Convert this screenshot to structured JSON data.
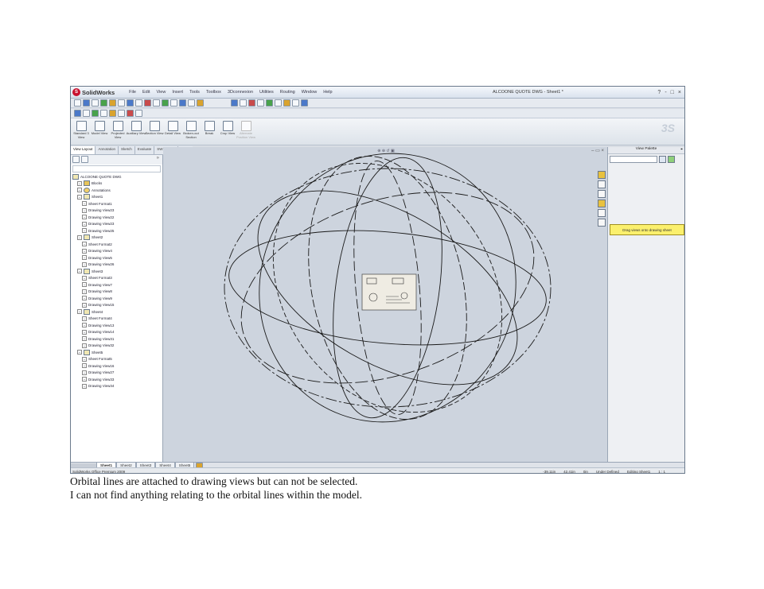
{
  "app": {
    "name": "SolidWorks",
    "menus": [
      "File",
      "Edit",
      "View",
      "Insert",
      "Tools",
      "Toolbox",
      "3Dconnexion",
      "Utilities",
      "Routing",
      "Window",
      "Help"
    ],
    "document_title": "ALCOONE QUOTE DWG - Sheet1 *",
    "window_controls": [
      "?",
      "-",
      "□",
      "×"
    ]
  },
  "command_manager": {
    "buttons": [
      {
        "label": "Standard 3 View",
        "disabled": false
      },
      {
        "label": "Model View",
        "disabled": false
      },
      {
        "label": "Projected View",
        "disabled": false
      },
      {
        "label": "Auxiliary View",
        "disabled": false
      },
      {
        "label": "Section View",
        "disabled": false
      },
      {
        "label": "Detail View",
        "disabled": false
      },
      {
        "label": "Broken-out Section",
        "disabled": false
      },
      {
        "label": "Break",
        "disabled": false
      },
      {
        "label": "Crop View",
        "disabled": false
      },
      {
        "label": "Alternate Position View",
        "disabled": true
      }
    ]
  },
  "tabs": [
    "View Layout",
    "Annotation",
    "Sketch",
    "Evaluate",
    "SWSimport"
  ],
  "tree": {
    "nodes": [
      {
        "label": "ALCOONE QUOTE DWG",
        "level": 0,
        "icon": "sheet"
      },
      {
        "label": "Blocks",
        "level": 1,
        "icon": "folder"
      },
      {
        "label": "Annotations",
        "level": 1,
        "icon": "anno"
      },
      {
        "label": "Sheet1",
        "level": 1,
        "icon": "sheet"
      },
      {
        "label": "Sheet Format1",
        "level": 2,
        "icon": "view"
      },
      {
        "label": "Drawing View23",
        "level": 2,
        "icon": "view"
      },
      {
        "label": "Drawing View22",
        "level": 2,
        "icon": "view"
      },
      {
        "label": "Drawing View23",
        "level": 2,
        "icon": "view"
      },
      {
        "label": "Drawing View25",
        "level": 2,
        "icon": "view"
      },
      {
        "label": "Sheet2",
        "level": 1,
        "icon": "sheet"
      },
      {
        "label": "Sheet Format2",
        "level": 2,
        "icon": "view"
      },
      {
        "label": "Drawing View4",
        "level": 2,
        "icon": "view"
      },
      {
        "label": "Drawing View5",
        "level": 2,
        "icon": "view"
      },
      {
        "label": "Drawing View26",
        "level": 2,
        "icon": "view"
      },
      {
        "label": "Sheet3",
        "level": 1,
        "icon": "sheet"
      },
      {
        "label": "Sheet Format3",
        "level": 2,
        "icon": "view"
      },
      {
        "label": "Drawing View7",
        "level": 2,
        "icon": "view"
      },
      {
        "label": "Drawing View8",
        "level": 2,
        "icon": "view"
      },
      {
        "label": "Drawing View9",
        "level": 2,
        "icon": "view"
      },
      {
        "label": "Drawing View15",
        "level": 2,
        "icon": "view"
      },
      {
        "label": "Sheet4",
        "level": 1,
        "icon": "sheet"
      },
      {
        "label": "Sheet Format4",
        "level": 2,
        "icon": "view"
      },
      {
        "label": "Drawing View13",
        "level": 2,
        "icon": "view"
      },
      {
        "label": "Drawing View14",
        "level": 2,
        "icon": "view"
      },
      {
        "label": "Drawing View31",
        "level": 2,
        "icon": "view"
      },
      {
        "label": "Drawing View32",
        "level": 2,
        "icon": "view"
      },
      {
        "label": "Sheet5",
        "level": 1,
        "icon": "sheet"
      },
      {
        "label": "Sheet Format5",
        "level": 2,
        "icon": "view"
      },
      {
        "label": "Drawing View16",
        "level": 2,
        "icon": "view"
      },
      {
        "label": "Drawing View27",
        "level": 2,
        "icon": "view"
      },
      {
        "label": "Drawing View33",
        "level": 2,
        "icon": "view"
      },
      {
        "label": "Drawing View34",
        "level": 2,
        "icon": "view"
      }
    ]
  },
  "view_palette": {
    "title": "View Palette",
    "drag_note": "Drag views onto drawing sheet"
  },
  "sheet_tabs": [
    "Sheet1",
    "Sheet2",
    "Sheet3",
    "Sheet4",
    "Sheet5"
  ],
  "status": {
    "left": "SolidWorks Office Premium 2009",
    "right": [
      "-39.11in",
      "42.41in",
      "0in",
      "Under Defined",
      "Editing Sheet1",
      "1 : 1"
    ]
  },
  "caption": [
    "Orbital lines are attached to drawing views but can not be selected.",
    "I can not find anything relating to the orbital lines within the model."
  ],
  "colors": {
    "graphics_background": "#cdd4de",
    "drag_note_background": "#fbf06d",
    "logo_red": "#c8102e"
  }
}
